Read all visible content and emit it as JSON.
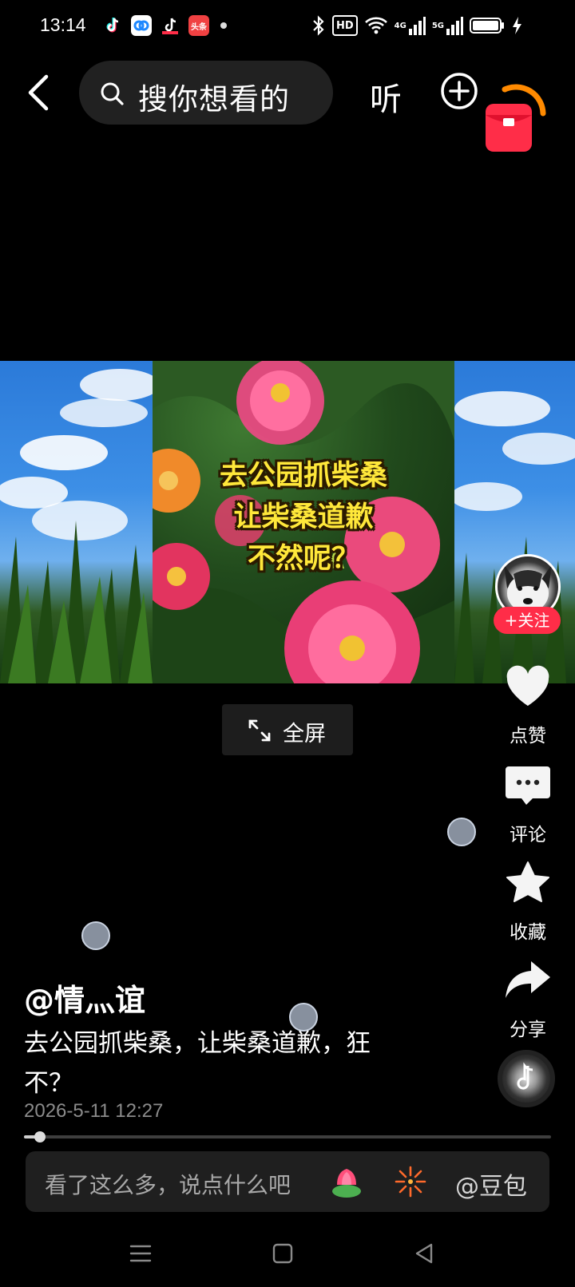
{
  "status_bar": {
    "time": "13:14",
    "hd_label": "HD",
    "net_1": "4G",
    "net_2": "5G",
    "toutiao_label": "头条"
  },
  "top_nav": {
    "search_placeholder": "搜你想看的",
    "listen_label": "听"
  },
  "video": {
    "caption_lines": [
      "去公园抓柴桑",
      "让柴桑道歉",
      "不然呢？"
    ]
  },
  "fullscreen_label": "全屏",
  "rail": {
    "follow_label": "+关注",
    "like_label": "点赞",
    "comment_label": "评论",
    "favorite_label": "收藏",
    "share_label": "分享"
  },
  "post": {
    "author": "@情灬谊",
    "description": "去公园抓柴桑，让柴桑道歉，狂不？",
    "date": "2026-5-11 12:27",
    "progress": 0.03
  },
  "comment_bar": {
    "placeholder": "看了这么多，说点什么吧",
    "mention": "@豆包"
  },
  "colors": {
    "accent_red": "#ff2d48",
    "caption_yellow": "#ffe83a"
  }
}
